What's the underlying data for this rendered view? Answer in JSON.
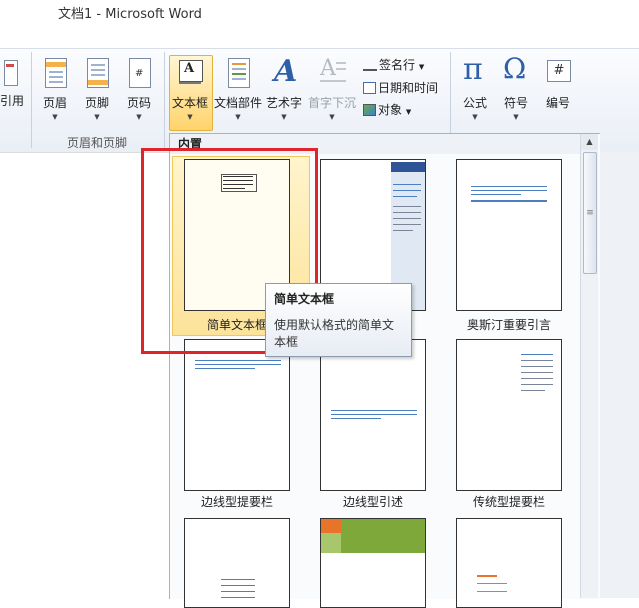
{
  "window": {
    "title": "文档1 - Microsoft Word"
  },
  "ribbon": {
    "partial_left_label": "引用",
    "header_footer_group": {
      "label": "页眉和页脚",
      "buttons": [
        "页眉",
        "页脚",
        "页码"
      ]
    },
    "text_group": {
      "big_buttons": [
        "文本框",
        "文档部件",
        "艺术字",
        "首字下沉"
      ],
      "small_buttons": [
        "签名行",
        "日期和时间",
        "对象"
      ]
    },
    "symbols_group": {
      "buttons": [
        "公式",
        "符号",
        "编号"
      ]
    },
    "icon_glyphs": {
      "equation": "π",
      "symbol": "Ω",
      "number": "#"
    }
  },
  "gallery": {
    "section_label": "内置",
    "items": [
      "简单文本框",
      "",
      "奥斯汀重要引言",
      "边线型提要栏",
      "边线型引述",
      "传统型提要栏"
    ]
  },
  "tooltip": {
    "title": "简单文本框",
    "description": "使用默认格式的简单文本框"
  },
  "colors": {
    "highlight_box": "#e0242b",
    "selected": "#ffd36b"
  }
}
